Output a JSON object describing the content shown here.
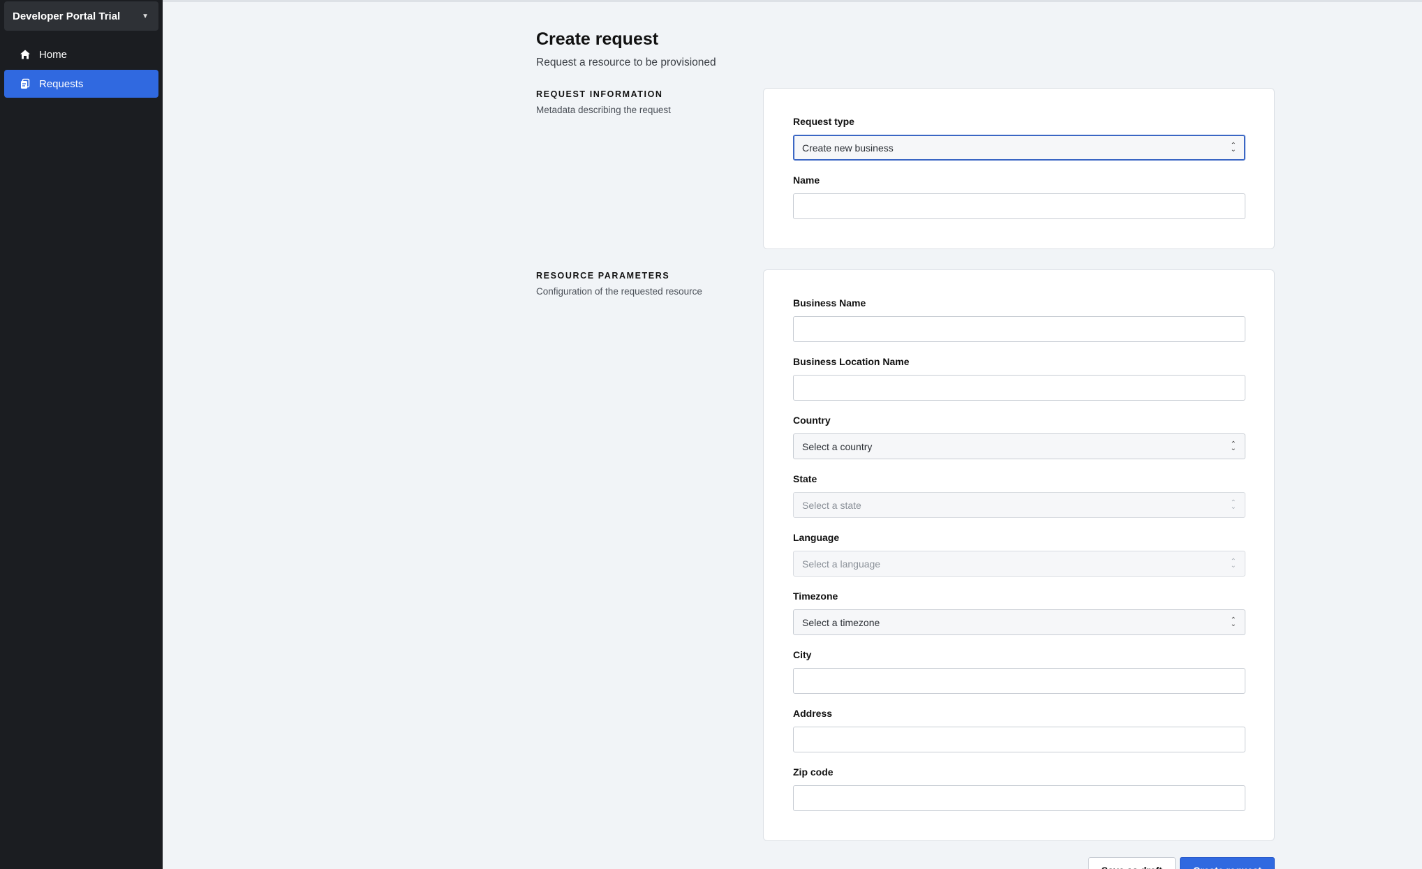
{
  "sidebar": {
    "workspace": "Developer Portal Trial",
    "items": [
      {
        "label": "Home",
        "icon": "home-icon",
        "active": false
      },
      {
        "label": "Requests",
        "icon": "requests-icon",
        "active": true
      }
    ]
  },
  "page": {
    "title": "Create request",
    "subtitle": "Request a resource to be provisioned"
  },
  "request_info": {
    "heading": "REQUEST INFORMATION",
    "description": "Metadata describing the request",
    "request_type_label": "Request type",
    "request_type_value": "Create new business",
    "name_label": "Name",
    "name_value": ""
  },
  "resource_params": {
    "heading": "RESOURCE PARAMETERS",
    "description": "Configuration of the requested resource",
    "business_name_label": "Business Name",
    "business_location_label": "Business Location Name",
    "country_label": "Country",
    "country_value": "Select a country",
    "state_label": "State",
    "state_value": "Select a state",
    "language_label": "Language",
    "language_value": "Select a language",
    "timezone_label": "Timezone",
    "timezone_value": "Select a timezone",
    "city_label": "City",
    "address_label": "Address",
    "zip_label": "Zip code"
  },
  "actions": {
    "save_draft": "Save as draft",
    "create": "Create request"
  },
  "colors": {
    "accent": "#3069e0",
    "sidebar_bg": "#1b1d21"
  }
}
